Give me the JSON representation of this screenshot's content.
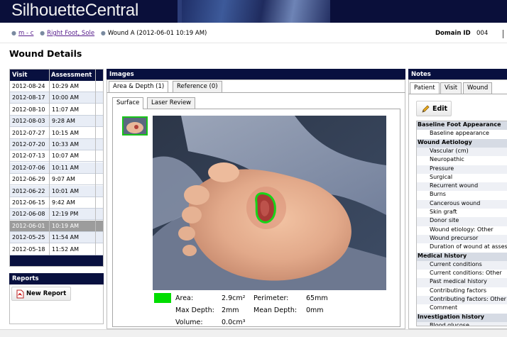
{
  "app": {
    "title": "SilhouetteCentral"
  },
  "breadcrumb": {
    "items": [
      "m - c",
      "Right Foot, Sole"
    ],
    "current": "Wound A (2012-06-01 10:19 AM)"
  },
  "domain": {
    "label": "Domain ID",
    "value": "004"
  },
  "page_title": "Wound Details",
  "visits": {
    "col_visit": "Visit",
    "col_assessment": "Assessment",
    "selected_index": 12,
    "rows": [
      {
        "date": "2012-08-24",
        "time": "10:29 AM"
      },
      {
        "date": "2012-08-17",
        "time": "10:00 AM"
      },
      {
        "date": "2012-08-10",
        "time": "11:07 AM"
      },
      {
        "date": "2012-08-03",
        "time": "9:28 AM"
      },
      {
        "date": "2012-07-27",
        "time": "10:15 AM"
      },
      {
        "date": "2012-07-20",
        "time": "10:33 AM"
      },
      {
        "date": "2012-07-13",
        "time": "10:07 AM"
      },
      {
        "date": "2012-07-06",
        "time": "10:11 AM"
      },
      {
        "date": "2012-06-29",
        "time": "9:07 AM"
      },
      {
        "date": "2012-06-22",
        "time": "10:01 AM"
      },
      {
        "date": "2012-06-15",
        "time": "9:42 AM"
      },
      {
        "date": "2012-06-08",
        "time": "12:19 PM"
      },
      {
        "date": "2012-06-01",
        "time": "10:19 AM"
      },
      {
        "date": "2012-05-25",
        "time": "11:54 AM"
      },
      {
        "date": "2012-05-18",
        "time": "11:52 AM"
      }
    ]
  },
  "reports": {
    "header": "Reports",
    "new_report_label": "New Report",
    "icon": "pdf-icon"
  },
  "images": {
    "header": "Images",
    "tabs": [
      "Area & Depth (1)",
      "Reference (0)"
    ],
    "subtabs": [
      "Surface",
      "Laser Review"
    ],
    "legend_color": "#00dd00",
    "measurements": {
      "area_label": "Area:",
      "area_value": "2.9cm²",
      "perimeter_label": "Perimeter:",
      "perimeter_value": "65mm",
      "max_depth_label": "Max Depth:",
      "max_depth_value": "2mm",
      "mean_depth_label": "Mean Depth:",
      "mean_depth_value": "0mm",
      "volume_label": "Volume:",
      "volume_value": "0.0cm³"
    }
  },
  "notes": {
    "header": "Notes",
    "tabs": [
      "Patient",
      "Visit",
      "Wound"
    ],
    "edit_label": "Edit",
    "edit_icon": "pencil-icon",
    "sections": [
      {
        "title": "Baseline Foot Appearance",
        "items": [
          "Baseline appearance"
        ]
      },
      {
        "title": "Wound Aetiology",
        "items": [
          "Vascular (cm)",
          "Neuropathic",
          "Pressure",
          "Surgical",
          "Recurrent wound",
          "Burns",
          "Cancerous wound",
          "Skin graft",
          "Donor site",
          "Wound etiology: Other",
          "Wound precursor",
          "Duration of wound at assessment"
        ]
      },
      {
        "title": "Medical history",
        "items": [
          "Current conditions",
          "Current conditions: Other",
          "Past medical history",
          "Contributing factors",
          "Contributing factors: Other",
          "Comment"
        ]
      },
      {
        "title": "Investigation history",
        "items": [
          "Blood glucose"
        ]
      }
    ]
  },
  "colors": {
    "header_bg": "#0a0f3a",
    "panel_header": "#08103f",
    "selected_row": "#9c9c9c",
    "wound_outline": "#18c418"
  }
}
